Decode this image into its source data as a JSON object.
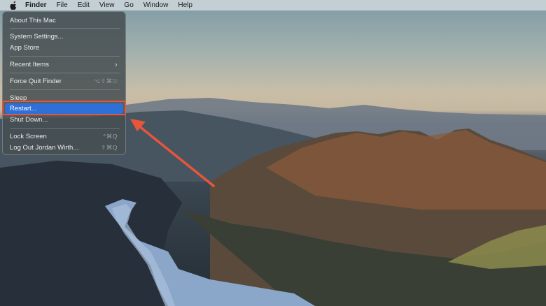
{
  "menubar": {
    "apple_icon": "apple-icon",
    "app_name": "Finder",
    "menus": [
      "File",
      "Edit",
      "View",
      "Go",
      "Window",
      "Help"
    ]
  },
  "apple_menu": {
    "items": [
      {
        "label": "About This Mac",
        "shortcut": ""
      },
      {
        "label": "System Settings...",
        "shortcut": ""
      },
      {
        "label": "App Store",
        "shortcut": ""
      },
      {
        "label": "Recent Items",
        "shortcut": "›"
      },
      {
        "label": "Force Quit Finder",
        "shortcut": "⌥⇧⌘⎋"
      },
      {
        "label": "Sleep",
        "shortcut": ""
      },
      {
        "label": "Restart...",
        "shortcut": ""
      },
      {
        "label": "Shut Down...",
        "shortcut": ""
      },
      {
        "label": "Lock Screen",
        "shortcut": "^⌘Q"
      },
      {
        "label": "Log Out Jordan Wirth...",
        "shortcut": "⇧⌘Q"
      }
    ],
    "highlighted_index": 6
  },
  "colors": {
    "highlight": "#2f6fd8",
    "annotation": "#e8553a"
  }
}
